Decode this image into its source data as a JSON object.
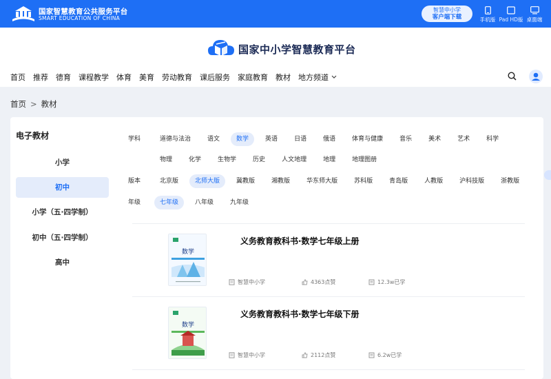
{
  "topbar": {
    "brand_cn": "国家智慧教育公共服务平台",
    "brand_en": "SMART EDUCATION OF CHINA",
    "client_line1": "智慧中小学",
    "client_line2": "客户端下载",
    "devices": [
      "手机版",
      "Pad HD版",
      "桌面端"
    ]
  },
  "header": {
    "title": "国家中小学智慧教育平台",
    "nav": [
      "首页",
      "推荐",
      "德育",
      "课程教学",
      "体育",
      "美育",
      "劳动教育",
      "课后服务",
      "家庭教育",
      "教材",
      "地方频道"
    ]
  },
  "breadcrumb": {
    "home": "首页",
    "sep": ">",
    "current": "教材"
  },
  "sidebar": {
    "title": "电子教材",
    "items": [
      "小学",
      "初中",
      "小学（五·四学制）",
      "初中（五·四学制）",
      "高中"
    ],
    "active_index": 1
  },
  "filters": {
    "subject_label": "学科",
    "subjects_row1": [
      "道德与法治",
      "语文",
      "数学",
      "英语",
      "日语",
      "俄语",
      "体育与健康",
      "音乐",
      "美术",
      "艺术",
      "科学"
    ],
    "subjects_row2": [
      "物理",
      "化学",
      "生物学",
      "历史",
      "人文地理",
      "地理",
      "地理图册"
    ],
    "selected_subject": "数学",
    "version_label": "版本",
    "versions": [
      "北京版",
      "北师大版",
      "冀教版",
      "湘教版",
      "华东师大版",
      "苏科版",
      "青岛版",
      "人教版",
      "沪科技版",
      "浙教版"
    ],
    "selected_version": "北师大版",
    "grade_label": "年级",
    "grades": [
      "七年级",
      "八年级",
      "九年级"
    ],
    "selected_grade": "七年级"
  },
  "books": [
    {
      "title": "义务教育教科书·数学七年级上册",
      "publisher": "智慧中小学",
      "likes": "4363点赞",
      "learners": "12.3w已学"
    },
    {
      "title": "义务教育教科书·数学七年级下册",
      "publisher": "智慧中小学",
      "likes": "2112点赞",
      "learners": "6.2w已学"
    }
  ],
  "cover_text": {
    "subject": "数学"
  },
  "colors": {
    "primary": "#1e6ff5",
    "selected_bg": "#e4ecfb"
  },
  "icons": [
    "logo-icon",
    "phone-icon",
    "pad-icon",
    "desktop-icon",
    "search-icon",
    "user-icon",
    "chevron-down-icon",
    "book-icon",
    "thumb-up-icon",
    "learn-icon"
  ]
}
